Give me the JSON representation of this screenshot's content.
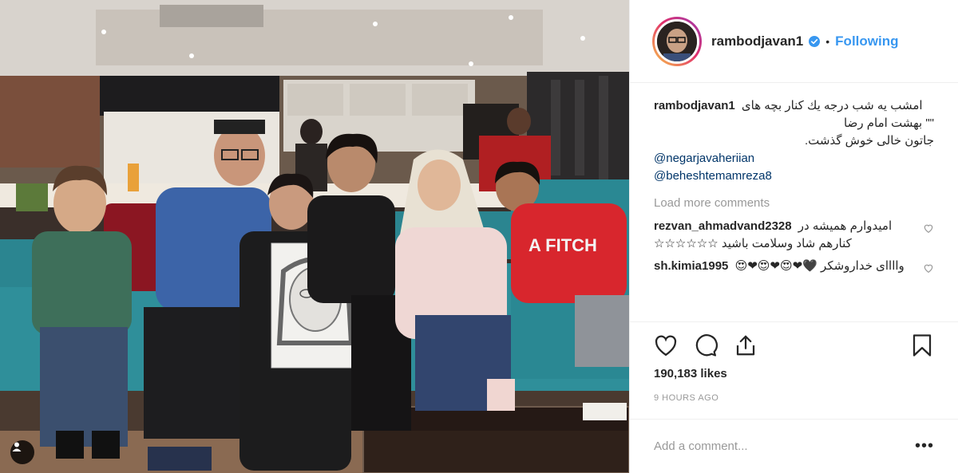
{
  "post": {
    "username": "rambodjavan1",
    "follow_label": "Following",
    "separator": "•"
  },
  "caption": {
    "username": "rambodjavan1",
    "lines": [
      "امشب یه شب درجه یك كنار بچه های",
      "\"\" بهشت امام رضا",
      "جاتون خالی خوش گذشت."
    ],
    "mentions": [
      "@negarjavaheriian",
      "@beheshtemamreza8"
    ]
  },
  "load_more_label": "Load more comments",
  "comments": [
    {
      "username": "rezvan_ahmadvand2328",
      "text": "امیدوارم همیشه در كنارهم شاد وسلامت باشید ☆☆☆☆☆☆"
    },
    {
      "username": "sh.kimia1995",
      "text": "واااای خداروشكر 🖤❤😍❤😍❤😍"
    }
  ],
  "likes_label": "190,183 likes",
  "time_label": "9 HOURS AGO",
  "add_comment_placeholder": "Add a comment...",
  "more_label": "•••",
  "icons": {
    "verified": "verified-badge-icon",
    "like": "heart-icon",
    "comment": "comment-bubble-icon",
    "share": "share-icon",
    "save": "bookmark-icon",
    "tag": "person-tag-icon"
  },
  "colors": {
    "link": "#3897f0",
    "mention": "#003569",
    "muted": "#999999",
    "border": "#efefef",
    "sofa": "#2f8f9a"
  }
}
